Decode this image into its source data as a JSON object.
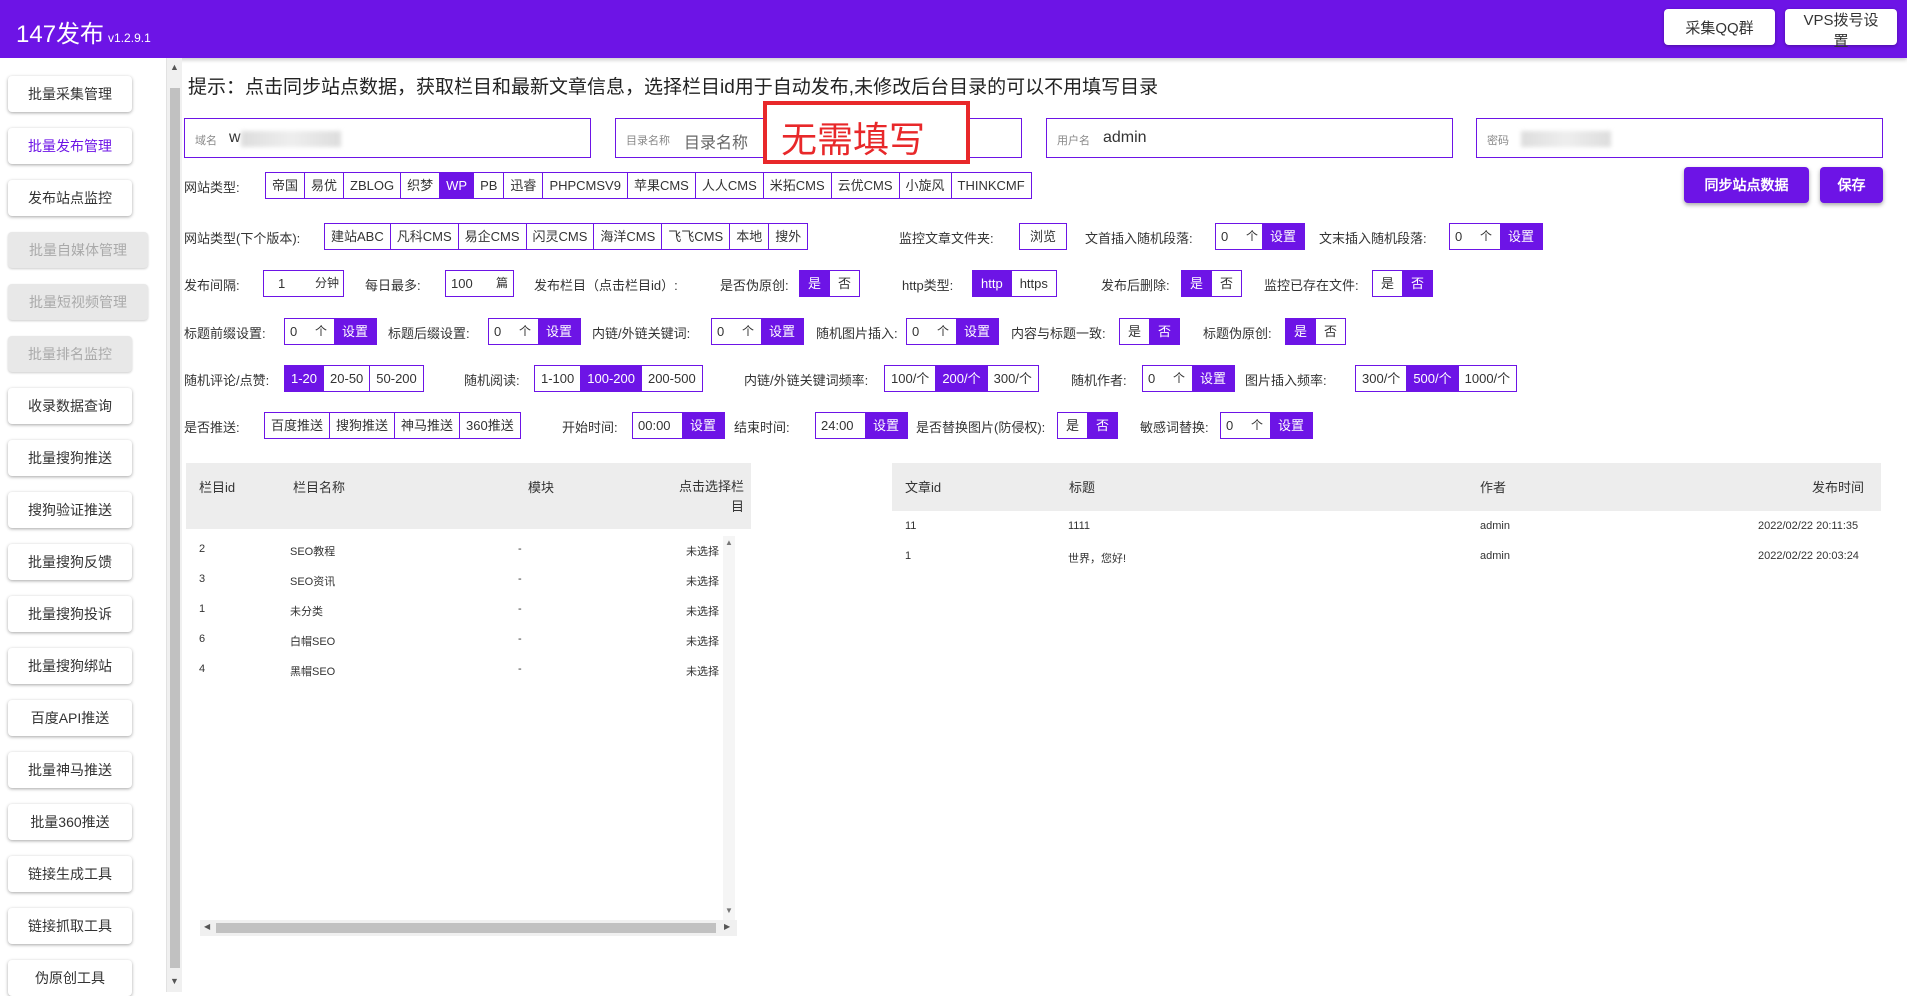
{
  "header": {
    "app_name": "147发布",
    "version": "v1.2.9.1",
    "qq_group_label": "采集QQ群",
    "vps_label": "VPS拨号设置"
  },
  "sidebar": {
    "items": [
      {
        "label": "批量采集管理"
      },
      {
        "label": "批量发布管理"
      },
      {
        "label": "发布站点监控"
      },
      {
        "label": "批量自媒体管理"
      },
      {
        "label": "批量短视频管理"
      },
      {
        "label": "批量排名监控"
      },
      {
        "label": "收录数据查询"
      },
      {
        "label": "批量搜狗推送"
      },
      {
        "label": "搜狗验证推送"
      },
      {
        "label": "批量搜狗反馈"
      },
      {
        "label": "批量搜狗投诉"
      },
      {
        "label": "批量搜狗绑站"
      },
      {
        "label": "百度API推送"
      },
      {
        "label": "批量神马推送"
      },
      {
        "label": "批量360推送"
      },
      {
        "label": "链接生成工具"
      },
      {
        "label": "链接抓取工具"
      },
      {
        "label": "伪原创工具"
      }
    ]
  },
  "hint": "提示：点击同步站点数据，获取栏目和最新文章信息，选择栏目id用于自动发布,未修改后台目录的可以不用填写目录",
  "fields": {
    "domain_label": "域名",
    "domain_value": "w",
    "dir_label": "目录名称",
    "dir_placeholder": "目录名称",
    "user_label": "用户名",
    "user_value": "admin",
    "pwd_label": "密码"
  },
  "annotation": "无需填写",
  "site_type": {
    "label": "网站类型:",
    "options": [
      "帝国",
      "易优",
      "ZBLOG",
      "织梦",
      "WP",
      "PB",
      "迅睿",
      "PHPCMSV9",
      "苹果CMS",
      "人人CMS",
      "米拓CMS",
      "云优CMS",
      "小旋风",
      "THINKCMF"
    ]
  },
  "site_type2": {
    "label": "网站类型(下个版本):",
    "options": [
      "建站ABC",
      "凡科CMS",
      "易企CMS",
      "闪灵CMS",
      "海洋CMS",
      "飞飞CMS",
      "本地",
      "搜外"
    ]
  },
  "buttons": {
    "sync": "同步站点数据",
    "save": "保存"
  },
  "monitor": {
    "label": "监控文章文件夹:",
    "browse": "浏览"
  },
  "head_para": {
    "label": "文首插入随机段落:",
    "value": "0",
    "unit": "个",
    "set": "设置"
  },
  "tail_para": {
    "label": "文末插入随机段落:",
    "value": "0",
    "unit": "个",
    "set": "设置"
  },
  "interval": {
    "label": "发布间隔:",
    "value": "1",
    "unit": "分钟"
  },
  "daily_max": {
    "label": "每日最多:",
    "value": "100",
    "unit": "篇"
  },
  "column_label": "发布栏目（点击栏目id）:",
  "pseudo": {
    "label": "是否伪原创:",
    "yes": "是",
    "no": "否"
  },
  "http_type": {
    "label": "http类型:",
    "http": "http",
    "https": "https"
  },
  "del_after": {
    "label": "发布后删除:",
    "yes": "是",
    "no": "否"
  },
  "monitor_exist": {
    "label": "监控已存在文件:",
    "yes": "是",
    "no": "否"
  },
  "title_prefix": {
    "label": "标题前缀设置:",
    "value": "0",
    "unit": "个",
    "set": "设置"
  },
  "title_suffix": {
    "label": "标题后缀设置:",
    "value": "0",
    "unit": "个",
    "set": "设置"
  },
  "link_keyword": {
    "label": "内链/外链关键词:",
    "value": "0",
    "unit": "个",
    "set": "设置"
  },
  "rand_image": {
    "label": "随机图片插入:",
    "value": "0",
    "unit": "个",
    "set": "设置"
  },
  "content_title": {
    "label": "内容与标题一致:",
    "yes": "是",
    "no": "否"
  },
  "title_pseudo": {
    "label": "标题伪原创:",
    "yes": "是",
    "no": "否"
  },
  "rand_comment": {
    "label": "随机评论/点赞:",
    "options": [
      "1-20",
      "20-50",
      "50-200"
    ]
  },
  "rand_read": {
    "label": "随机阅读:",
    "options": [
      "1-100",
      "100-200",
      "200-500"
    ]
  },
  "link_freq": {
    "label": "内链/外链关键词频率:",
    "options": [
      "100/个",
      "200/个",
      "300/个"
    ]
  },
  "rand_author": {
    "label": "随机作者:",
    "value": "0",
    "unit": "个",
    "set": "设置"
  },
  "img_freq": {
    "label": "图片插入频率:",
    "options": [
      "300/个",
      "500/个",
      "1000/个"
    ]
  },
  "push": {
    "label": "是否推送:",
    "options": [
      "百度推送",
      "搜狗推送",
      "神马推送",
      "360推送"
    ]
  },
  "start_time": {
    "label": "开始时间:",
    "value": "00:00",
    "set": "设置"
  },
  "end_time": {
    "label": "结束时间:",
    "value": "24:00",
    "set": "设置"
  },
  "replace_img": {
    "label": "是否替换图片(防侵权):",
    "yes": "是",
    "no": "否"
  },
  "sensitive": {
    "label": "敏感词替换:",
    "value": "0",
    "unit": "个",
    "set": "设置"
  },
  "column_table": {
    "headers": [
      "栏目id",
      "栏目名称",
      "模块",
      "点击选择栏目"
    ],
    "rows": [
      [
        "2",
        "SEO教程",
        "-",
        "未选择"
      ],
      [
        "3",
        "SEO资讯",
        "-",
        "未选择"
      ],
      [
        "1",
        "未分类",
        "-",
        "未选择"
      ],
      [
        "6",
        "白帽SEO",
        "-",
        "未选择"
      ],
      [
        "4",
        "黑帽SEO",
        "-",
        "未选择"
      ]
    ]
  },
  "article_table": {
    "headers": [
      "文章id",
      "标题",
      "作者",
      "发布时间"
    ],
    "rows": [
      [
        "11",
        "1111",
        "admin",
        "2022/02/22 20:11:35"
      ],
      [
        "1",
        "世界，您好!",
        "admin",
        "2022/02/22 20:03:24"
      ]
    ]
  }
}
